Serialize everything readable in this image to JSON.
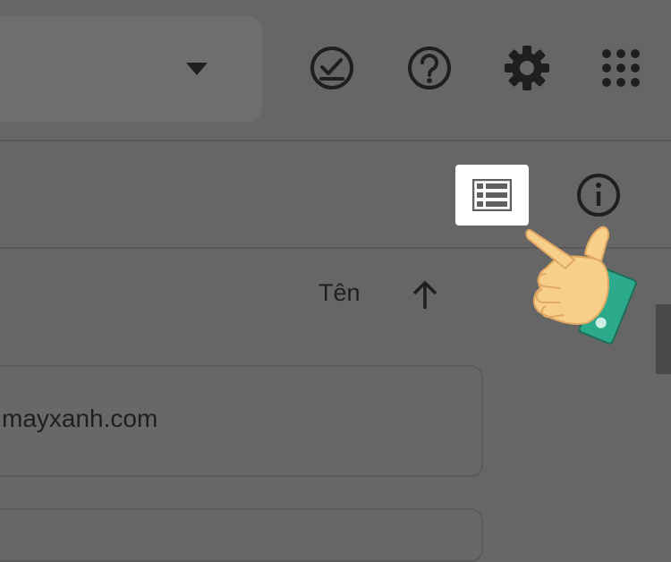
{
  "header": {
    "search_dropdown_icon": "caret-down-icon",
    "icons": [
      "checkmark-circle-icon",
      "help-icon",
      "settings-icon",
      "apps-grid-icon"
    ]
  },
  "toolbar": {
    "view_toggle_icon": "list-view-icon",
    "info_icon": "info-icon"
  },
  "list": {
    "sort_label": "Tên",
    "sort_icon": "arrow-up-icon",
    "files": [
      {
        "name": "mayxanh.com"
      },
      {
        "name": ""
      }
    ]
  },
  "overlay": {
    "pointer_icon": "pointing-hand-icon"
  },
  "colors": {
    "dim_overlay": "#666666",
    "highlight": "#ffffff",
    "cuff": "#2bab8c",
    "skin": "#f7cf8a"
  }
}
